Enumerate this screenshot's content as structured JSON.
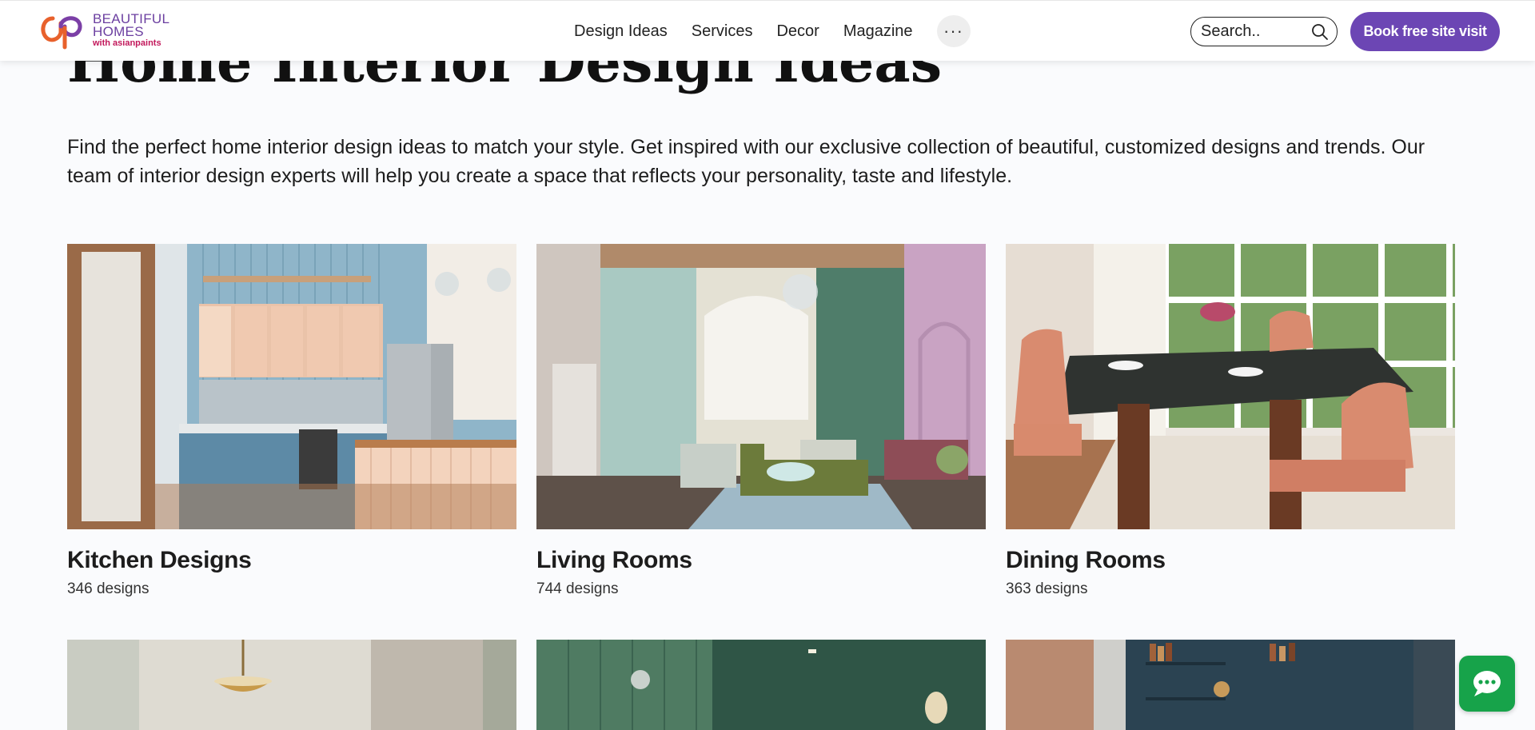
{
  "header": {
    "logo": {
      "line1": "BEAUTIFUL",
      "line2": "HOMES",
      "line3": "with asianpaints"
    },
    "nav": [
      {
        "label": "Design Ideas"
      },
      {
        "label": "Services"
      },
      {
        "label": "Decor"
      },
      {
        "label": "Magazine"
      }
    ],
    "more_label": "···",
    "search_placeholder": "Search..",
    "book_label": "Book free site visit",
    "accent": "#6c46b4"
  },
  "page": {
    "title": "Home Interior Design Ideas",
    "intro": "Find the perfect home interior design ideas to match your style. Get inspired with our exclusive collection of beautiful, customized designs and trends. Our team of interior design experts will help you create a space that reflects your personality, taste and lifestyle."
  },
  "categories": [
    {
      "title": "Kitchen Designs",
      "count": "346 designs"
    },
    {
      "title": "Living Rooms",
      "count": "744 designs"
    },
    {
      "title": "Dining Rooms",
      "count": "363 designs"
    }
  ],
  "icons": {
    "search": "search-icon",
    "more": "more-icon",
    "chat": "chat-icon"
  },
  "colors": {
    "chat": "#17a34a",
    "brand_purple": "#6b3fa0",
    "brand_pink": "#c2185b"
  }
}
